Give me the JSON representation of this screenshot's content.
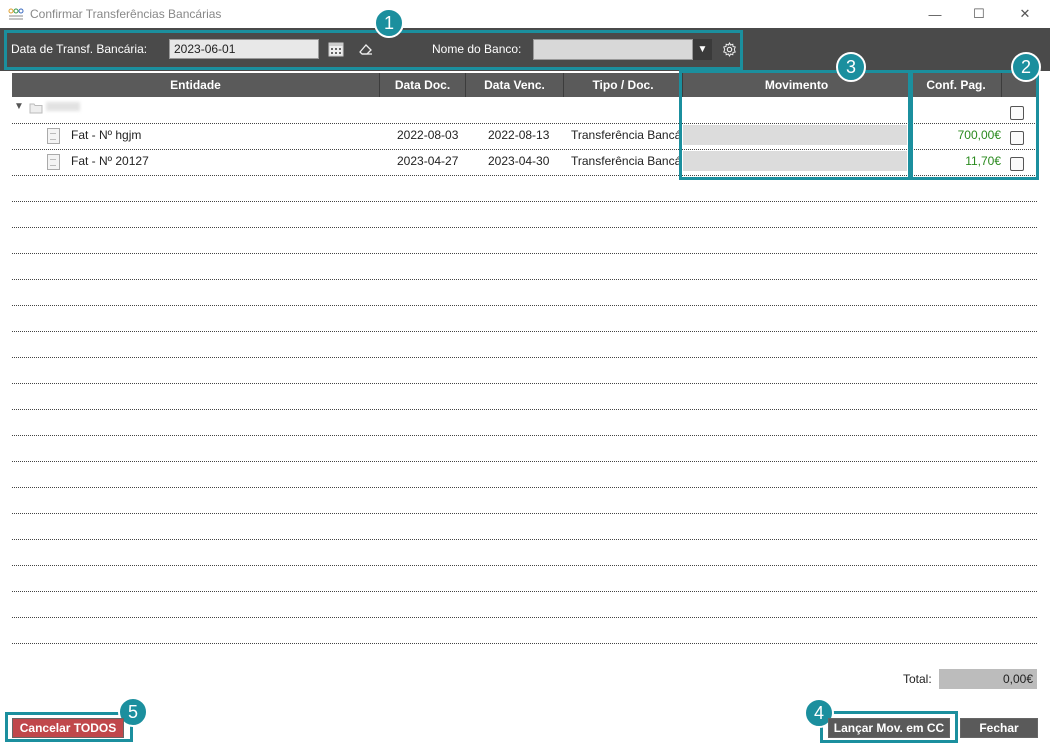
{
  "window": {
    "title": "Confirmar Transferências Bancárias",
    "minimize": "—",
    "maximize": "☐",
    "close": "✕"
  },
  "toolbar": {
    "date_label": "Data de Transf. Bancária:",
    "date_value": "2023-06-01",
    "bank_label": "Nome do Banco:",
    "bank_value": ""
  },
  "table": {
    "columns": [
      "Entidade",
      "Data Doc.",
      "Data Venc.",
      "Tipo / Doc.",
      "Movimento",
      "Conf. Pag.",
      ""
    ],
    "group": {
      "name": ""
    },
    "rows": [
      {
        "entidade": "Fat - Nº hgjm",
        "data_doc": "2022-08-03",
        "data_venc": "2022-08-13",
        "tipo": "Transferência Bancária",
        "movimento": "",
        "conf_pag": "700,00€",
        "checked": false
      },
      {
        "entidade": "Fat - Nº 20127",
        "data_doc": "2023-04-27",
        "data_venc": "2023-04-30",
        "tipo": "Transferência Bancária",
        "movimento": "",
        "conf_pag": "11,70€",
        "checked": false
      }
    ]
  },
  "footer": {
    "total_label": "Total:",
    "total_value": "0,00€",
    "cancel_all": "Cancelar TODOS",
    "post_movements": "Lançar Mov. em CC",
    "close": "Fechar"
  },
  "annotations": [
    "1",
    "2",
    "3",
    "4",
    "5"
  ],
  "colors": {
    "accent": "#1b8f9e",
    "amount": "#2a8a1e",
    "cancel": "#c0474b",
    "toolbar": "#4a4a4a"
  }
}
